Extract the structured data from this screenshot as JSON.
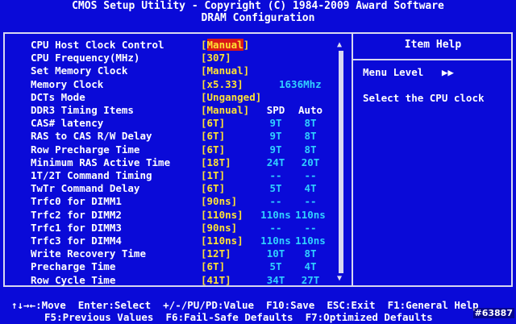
{
  "header": {
    "title": "CMOS Setup Utility - Copyright (C) 1984-2009 Award Software",
    "subtitle": "DRAM Configuration"
  },
  "settings": [
    {
      "label": "CPU Host Clock Control",
      "value": "[Manual]",
      "selected": true
    },
    {
      "label": "CPU Frequency(MHz)",
      "value": "[307]"
    },
    {
      "label": "Set Memory Clock",
      "value": "[Manual]"
    },
    {
      "label": "Memory Clock",
      "value": "[x5.33]",
      "extra": "1636Mhz"
    },
    {
      "label": "DCTs Mode",
      "value": "[Unganged]"
    },
    {
      "label": "DDR3 Timing Items",
      "value": "[Manual]",
      "spd": "SPD",
      "auto": "Auto",
      "header": true
    },
    {
      "label": "CAS# latency",
      "value": "[6T]",
      "spd": "9T",
      "auto": "8T"
    },
    {
      "label": "RAS to CAS R/W Delay",
      "value": "[6T]",
      "spd": "9T",
      "auto": "8T"
    },
    {
      "label": "Row Precharge Time",
      "value": "[6T]",
      "spd": "9T",
      "auto": "8T"
    },
    {
      "label": "Minimum RAS Active Time",
      "value": "[18T]",
      "spd": "24T",
      "auto": "20T"
    },
    {
      "label": "1T/2T Command Timing",
      "value": "[1T]",
      "spd": "--",
      "auto": "--"
    },
    {
      "label": "TwTr Command Delay",
      "value": "[6T]",
      "spd": "5T",
      "auto": "4T"
    },
    {
      "label": "Trfc0 for DIMM1",
      "value": "[90ns]",
      "spd": "--",
      "auto": "--"
    },
    {
      "label": "Trfc2 for DIMM2",
      "value": "[110ns]",
      "spd": "110ns",
      "auto": "110ns"
    },
    {
      "label": "Trfc1 for DIMM3",
      "value": "[90ns]",
      "spd": "--",
      "auto": "--"
    },
    {
      "label": "Trfc3 for DIMM4",
      "value": "[110ns]",
      "spd": "110ns",
      "auto": "110ns"
    },
    {
      "label": "Write Recovery Time",
      "value": "[12T]",
      "spd": "10T",
      "auto": "8T"
    },
    {
      "label": "Precharge Time",
      "value": "[6T]",
      "spd": "5T",
      "auto": "4T"
    },
    {
      "label": "Row Cycle Time",
      "value": "[41T]",
      "spd": "34T",
      "auto": "27T"
    }
  ],
  "help": {
    "title": "Item Help",
    "menu_level": "Menu Level",
    "menu_level_arrows": "▶▶",
    "text": "Select the CPU clock"
  },
  "scrollbar": {
    "up": "▲",
    "down": "▼"
  },
  "footer": {
    "line1": "↑↓→←:Move  Enter:Select  +/-/PU/PD:Value  F10:Save  ESC:Exit  F1:General Help",
    "line2": "F5:Previous Values  F6:Fail-Safe Defaults  F7:Optimized Defaults"
  },
  "watermark": "#63887"
}
